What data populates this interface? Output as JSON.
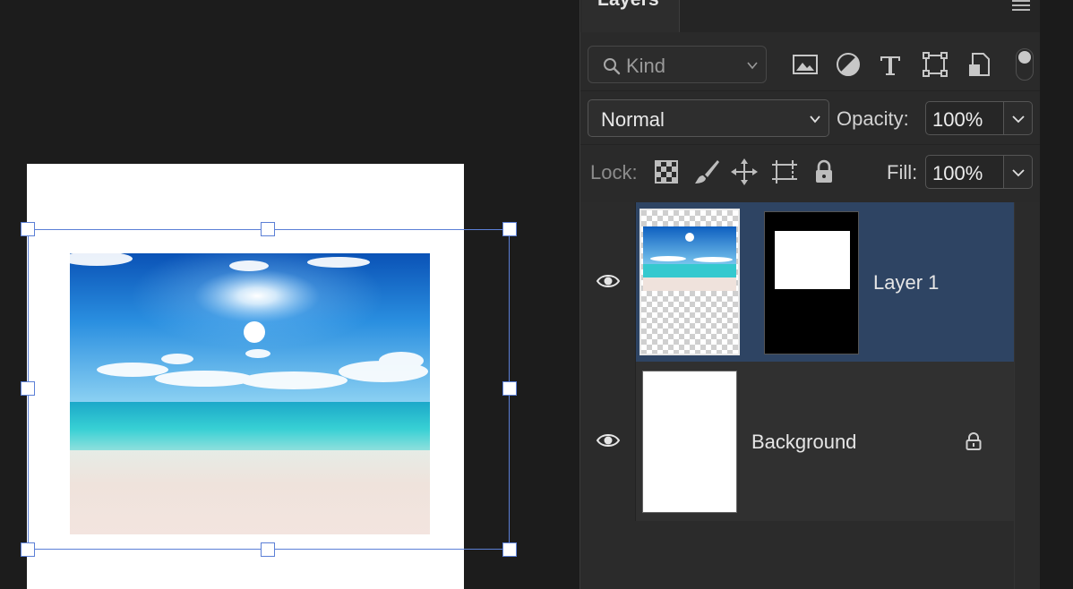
{
  "panel": {
    "tab_label": "Layers",
    "filter": {
      "placeholder": "Kind"
    },
    "blend_mode": "Normal",
    "opacity_label": "Opacity:",
    "opacity_value": "100%",
    "lock_label": "Lock:",
    "fill_label": "Fill:",
    "fill_value": "100%"
  },
  "layers": [
    {
      "name": "Layer 1",
      "visible": true,
      "selected": true,
      "has_mask": true
    },
    {
      "name": "Background",
      "visible": true,
      "selected": false,
      "locked": true
    }
  ],
  "colors": {
    "selection_accent": "#5b7fd6",
    "selected_row": "#2e4463"
  }
}
